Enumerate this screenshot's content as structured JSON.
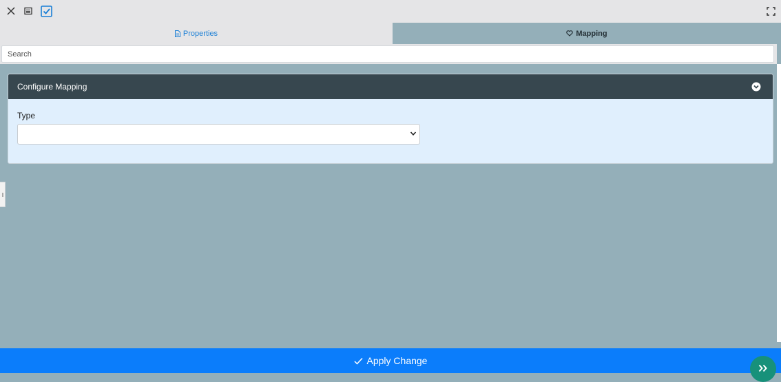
{
  "toolbar": {
    "close_icon": "close-icon",
    "form_icon": "form-icon",
    "checkbox_icon": "checkbox-icon",
    "fullscreen_icon": "fullscreen-icon"
  },
  "tabs": [
    {
      "label": "Properties",
      "icon": "document-icon",
      "active": false
    },
    {
      "label": "Mapping",
      "icon": "heart-icon",
      "active": true
    }
  ],
  "search": {
    "placeholder": "Search",
    "value": ""
  },
  "panel": {
    "title": "Configure Mapping",
    "collapse_icon": "chevron-circle-down-icon",
    "fields": [
      {
        "label": "Type",
        "value": ""
      }
    ]
  },
  "footer": {
    "apply_label": "Apply Change",
    "apply_icon": "check-icon",
    "fab_icon": "double-chevron-right-icon"
  },
  "colors": {
    "background": "#94afb9",
    "panel_header": "#37474f",
    "panel_body": "#e0effd",
    "accent": "#0b7dfb",
    "fab": "#17917a",
    "tab_active_text": "#1a7fd6"
  }
}
